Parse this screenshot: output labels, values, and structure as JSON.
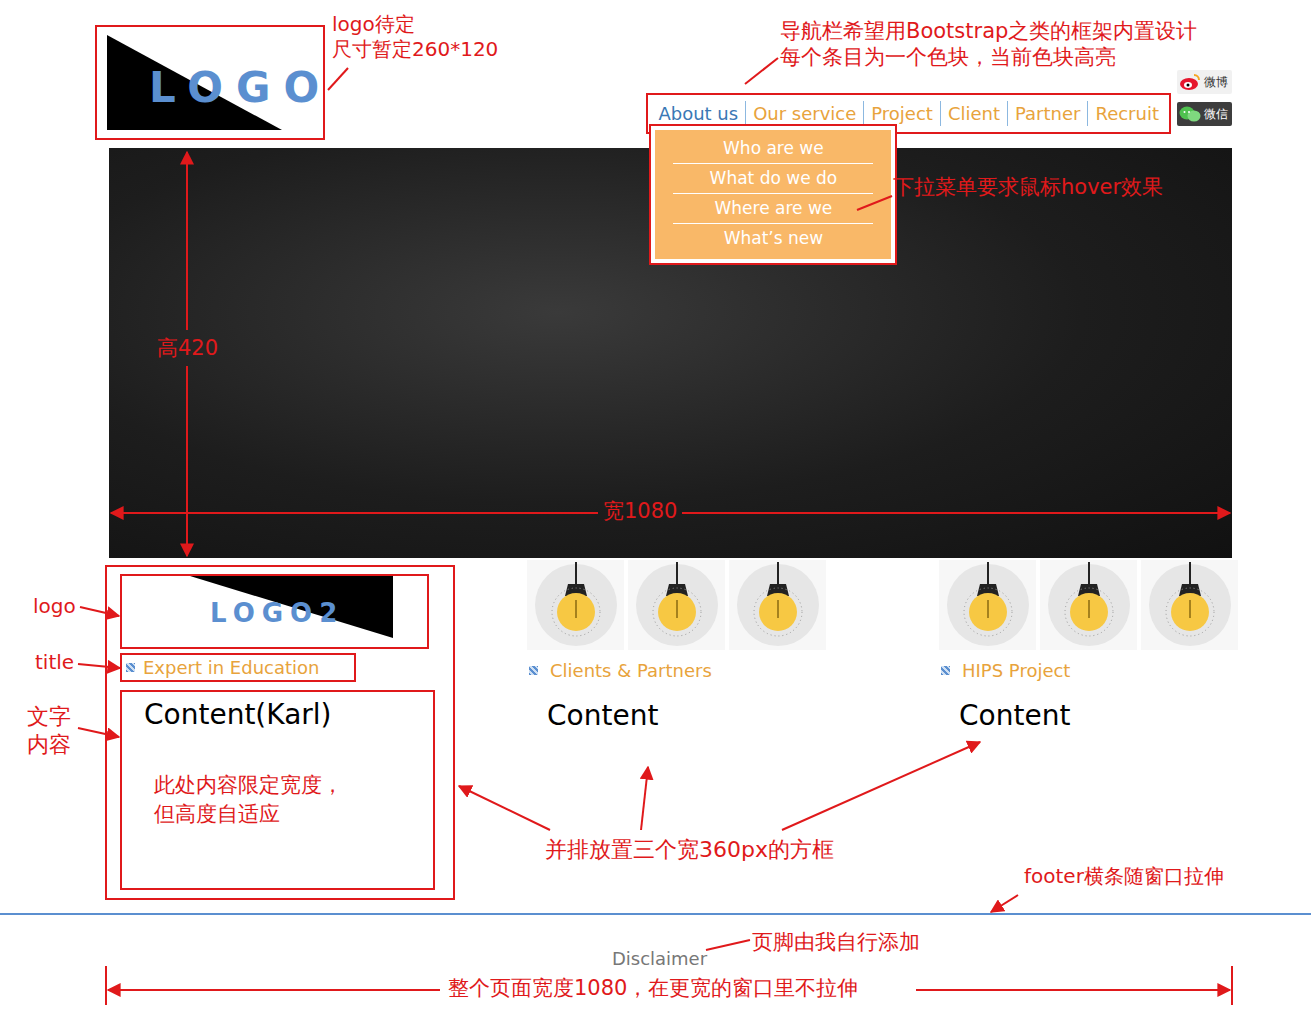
{
  "logo": {
    "text": "LOGO"
  },
  "nav": {
    "items": [
      {
        "label": "About us",
        "selected": true
      },
      {
        "label": "Our service",
        "selected": false
      },
      {
        "label": "Project",
        "selected": false
      },
      {
        "label": "Client",
        "selected": false
      },
      {
        "label": "Partner",
        "selected": false
      },
      {
        "label": "Recruit",
        "selected": false
      }
    ]
  },
  "social": [
    {
      "kind": "weibo",
      "label": "微博"
    },
    {
      "kind": "wechat",
      "label": "微信"
    }
  ],
  "dropdown": {
    "items": [
      "Who are we",
      "What do we do",
      "Where are we",
      "What’s new"
    ]
  },
  "columns": [
    {
      "kind": "logo",
      "logo": "LOGO2",
      "title": "Expert in Education",
      "content": "Content(Karl)",
      "note": "此处内容限定宽度，\n但高度自适应"
    },
    {
      "kind": "bulbs",
      "title": "Clients & Partners",
      "content": "Content"
    },
    {
      "kind": "bulbs",
      "title": "HIPS Project",
      "content": "Content"
    }
  ],
  "footer": {
    "text": "Disclaimer"
  },
  "annotations": {
    "logo_note": "logo待定\n尺寸暂定260*120",
    "nav_note": "导航栏希望用Bootstrap之类的框架内置设计\n每个条目为一个色块，当前色块高亮",
    "dropdown_note": "下拉菜单要求鼠标hover效果",
    "height_note": "高420",
    "width_note": "宽1080",
    "logo_label": "logo",
    "title_label": "title",
    "text_label": "文字\n内容",
    "columns_note": "并排放置三个宽360px的方框",
    "footer_note": "footer横条随窗口拉伸",
    "footer_self_note": "页脚由我自行添加",
    "page_width_note": "整个页面宽度1080，在更宽的窗口里不拉伸"
  }
}
